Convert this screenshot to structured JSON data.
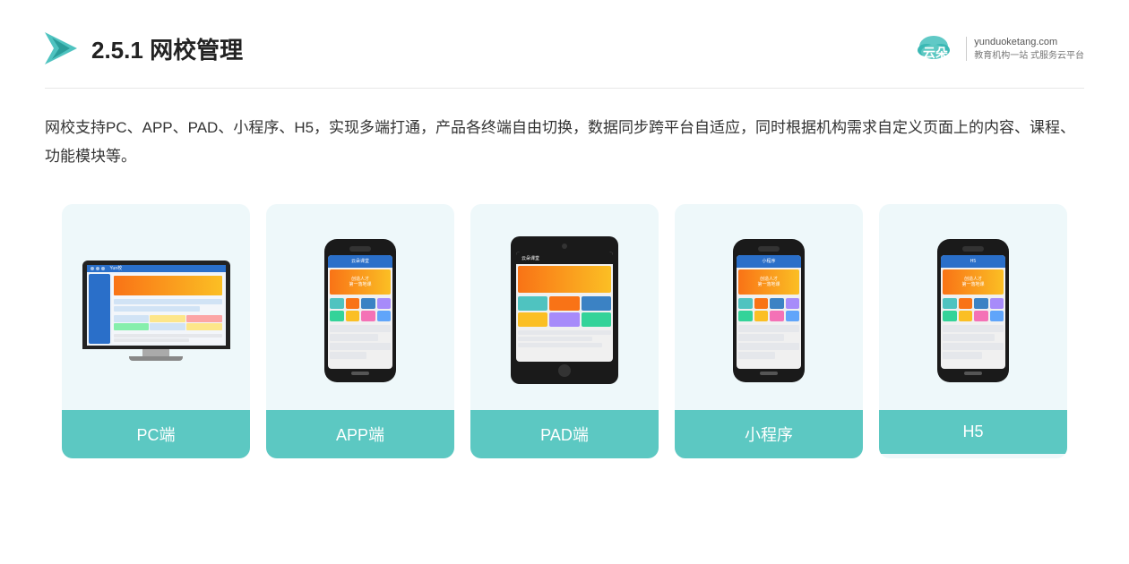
{
  "header": {
    "section_number": "2.5.1",
    "title": "网校管理",
    "brand": {
      "name": "云朵课堂",
      "site": "yunduoketang.com",
      "slogan_line1": "教育机构一站",
      "slogan_line2": "式服务云平台"
    }
  },
  "description": {
    "text": "网校支持PC、APP、PAD、小程序、H5，实现多端打通，产品各终端自由切换，数据同步跨平台自适应，同时根据机构需求自定义页面上的内容、课程、功能模块等。"
  },
  "cards": [
    {
      "id": "pc",
      "label": "PC端",
      "type": "monitor"
    },
    {
      "id": "app",
      "label": "APP端",
      "type": "phone"
    },
    {
      "id": "pad",
      "label": "PAD端",
      "type": "tablet"
    },
    {
      "id": "miniprogram",
      "label": "小程序",
      "type": "phone"
    },
    {
      "id": "h5",
      "label": "H5",
      "type": "phone"
    }
  ],
  "colors": {
    "card_bg": "#eef8fa",
    "card_label_bg": "#5cc8c2",
    "title_color": "#222",
    "text_color": "#333"
  }
}
